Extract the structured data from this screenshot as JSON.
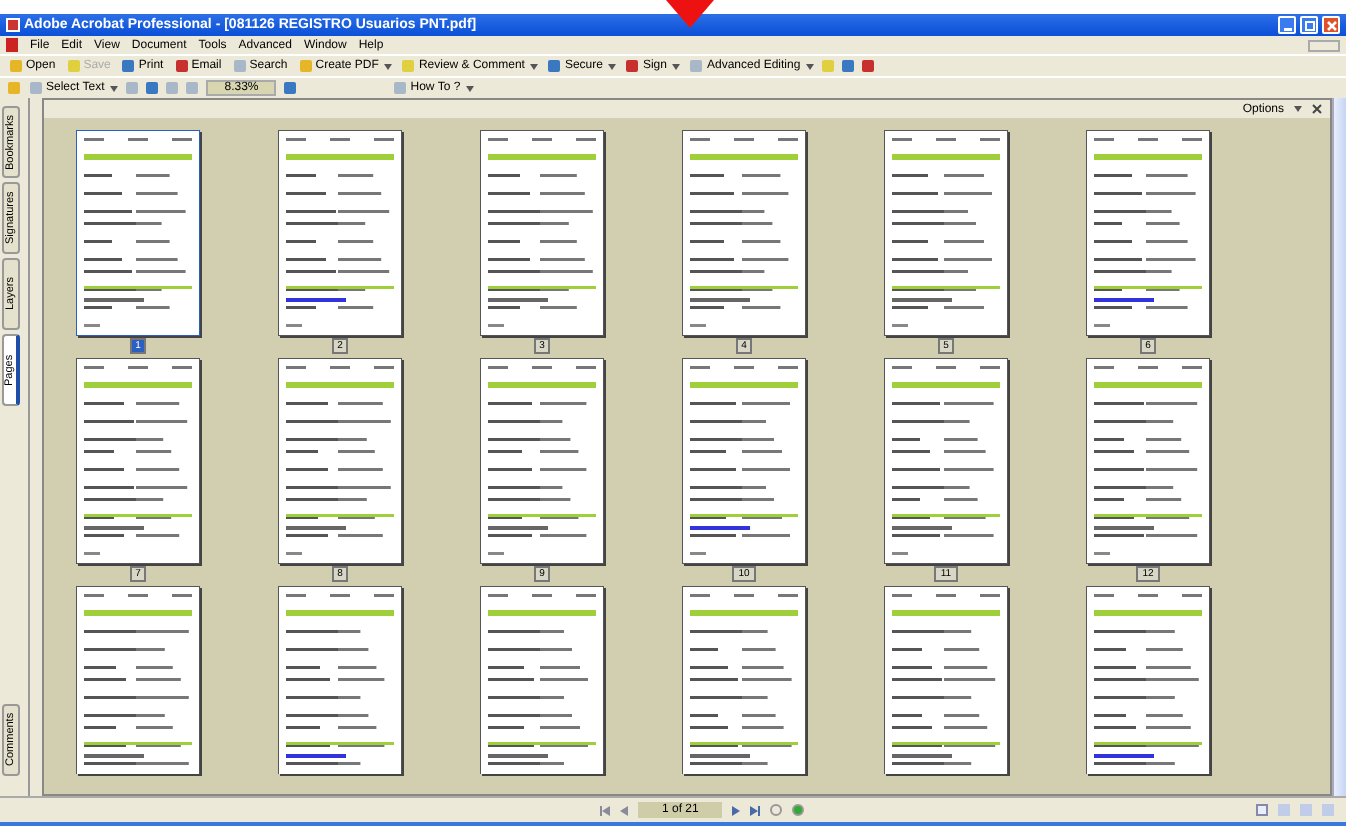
{
  "window": {
    "title": "Adobe Acrobat Professional - [081126 REGISTRO Usuarios PNT.pdf]"
  },
  "menu": [
    "File",
    "Edit",
    "View",
    "Document",
    "Tools",
    "Advanced",
    "Window",
    "Help"
  ],
  "toolbar": [
    {
      "label": "Open",
      "dropdown": false,
      "disabled": false
    },
    {
      "label": "Save",
      "dropdown": false,
      "disabled": true
    },
    {
      "label": "Print",
      "dropdown": false,
      "disabled": false
    },
    {
      "label": "Email",
      "dropdown": false,
      "disabled": false
    },
    {
      "label": "Search",
      "dropdown": false,
      "disabled": false
    },
    {
      "label": "Create PDF",
      "dropdown": true,
      "disabled": false
    },
    {
      "label": "Review & Comment",
      "dropdown": true,
      "disabled": false
    },
    {
      "label": "Secure",
      "dropdown": true,
      "disabled": false
    },
    {
      "label": "Sign",
      "dropdown": true,
      "disabled": false
    },
    {
      "label": "Advanced Editing",
      "dropdown": true,
      "disabled": false
    }
  ],
  "view_toolbar": {
    "select_tool": "Select Text",
    "zoom": "8.33%",
    "help": "How To ?"
  },
  "side_tabs": [
    {
      "label": "Bookmarks",
      "selected": false
    },
    {
      "label": "Signatures",
      "selected": false
    },
    {
      "label": "Layers",
      "selected": false
    },
    {
      "label": "Pages",
      "selected": true
    }
  ],
  "bottom_tab": {
    "label": "Comments",
    "selected": false
  },
  "options": "Options",
  "thumbnails": [
    {
      "label": "1",
      "selected": true
    },
    {
      "label": "2",
      "selected": false
    },
    {
      "label": "3",
      "selected": false
    },
    {
      "label": "4",
      "selected": false
    },
    {
      "label": "5",
      "selected": false
    },
    {
      "label": "6",
      "selected": false
    },
    {
      "label": "7",
      "selected": false
    },
    {
      "label": "8",
      "selected": false
    },
    {
      "label": "9",
      "selected": false
    },
    {
      "label": "10",
      "selected": false
    },
    {
      "label": "11",
      "selected": false
    },
    {
      "label": "12",
      "selected": false
    },
    {
      "selected": false
    },
    {
      "selected": false
    },
    {
      "selected": false
    },
    {
      "selected": false
    },
    {
      "selected": false
    },
    {
      "selected": false
    }
  ],
  "status_bar": {
    "page": "1 of 21"
  }
}
